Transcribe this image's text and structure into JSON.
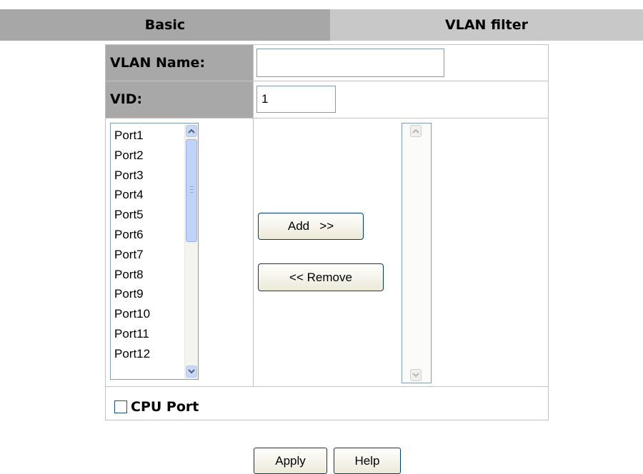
{
  "tabs": {
    "basic_label": "Basic",
    "vlan_filter_label": "VLAN filter"
  },
  "form": {
    "vlan_name_label": "VLAN Name:",
    "vlan_name_value": "",
    "vid_label": "VID:",
    "vid_value": "1"
  },
  "port_list": {
    "items": [
      "Port1",
      "Port2",
      "Port3",
      "Port4",
      "Port5",
      "Port6",
      "Port7",
      "Port8",
      "Port9",
      "Port10",
      "Port11",
      "Port12"
    ]
  },
  "buttons": {
    "add_label": "Add   >>",
    "remove_label": "<< Remove",
    "apply_label": "Apply",
    "help_label": "Help"
  },
  "cpu_port": {
    "label": "CPU Port",
    "checked": false
  },
  "icons": {
    "scroll_up": "chevron-up-icon",
    "scroll_down": "chevron-down-icon"
  },
  "colors": {
    "tab_basic_bg": "#a7a7a7",
    "tab_vlan_bg": "#c8c8c8",
    "label_bg": "#a8a8a8",
    "scroll_accent": "#c2d3fb"
  }
}
